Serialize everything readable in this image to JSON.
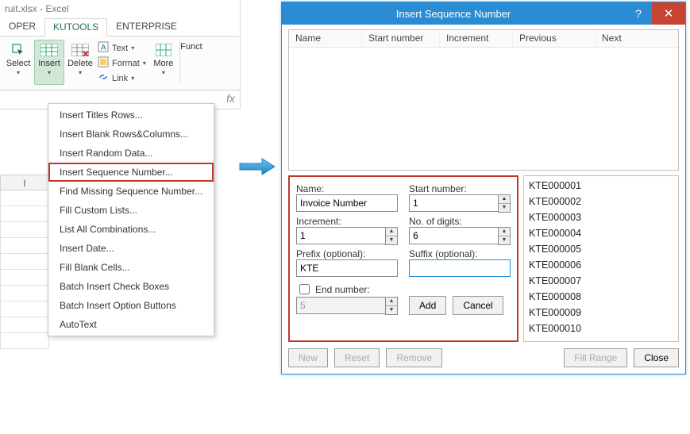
{
  "excel": {
    "title": "ruit.xlsx - Excel",
    "tabs": {
      "oper": "OPER",
      "kutools": "KUTOOLS",
      "enterprise": "ENTERPRISE"
    },
    "ribbon": {
      "select": "Select",
      "insert": "Insert",
      "delete": "Delete",
      "text": "Text",
      "format": "Format",
      "link": "Link",
      "more": "More",
      "funct": "Funct"
    },
    "col_header": "I",
    "fx": "fx"
  },
  "dropdown": [
    "Insert Titles Rows...",
    "Insert Blank Rows&Columns...",
    "Insert Random Data...",
    "Insert Sequence Number...",
    "Find Missing Sequence Number...",
    "Fill Custom Lists...",
    "List All Combinations...",
    "Insert Date...",
    "Fill Blank Cells...",
    "Batch Insert Check Boxes",
    "Batch Insert Option Buttons",
    "AutoText"
  ],
  "dialog": {
    "title": "Insert Sequence Number",
    "columns": {
      "name": "Name",
      "start": "Start number",
      "increment": "Increment",
      "previous": "Previous",
      "next": "Next"
    },
    "form": {
      "name_label": "Name:",
      "name_value": "Invoice Number",
      "start_label": "Start number:",
      "start_value": "1",
      "increment_label": "Increment:",
      "increment_value": "1",
      "digits_label": "No. of digits:",
      "digits_value": "6",
      "prefix_label": "Prefix (optional):",
      "prefix_value": "KTE",
      "suffix_label": "Suffix (optional):",
      "suffix_value": "",
      "end_label": "End number:",
      "end_value": "5",
      "btn_add": "Add",
      "btn_cancel": "Cancel"
    },
    "preview": [
      "KTE000001",
      "KTE000002",
      "KTE000003",
      "KTE000004",
      "KTE000005",
      "KTE000006",
      "KTE000007",
      "KTE000008",
      "KTE000009",
      "KTE000010"
    ],
    "footer": {
      "new": "New",
      "reset": "Reset",
      "remove": "Remove",
      "fill": "Fill Range",
      "close": "Close"
    }
  }
}
